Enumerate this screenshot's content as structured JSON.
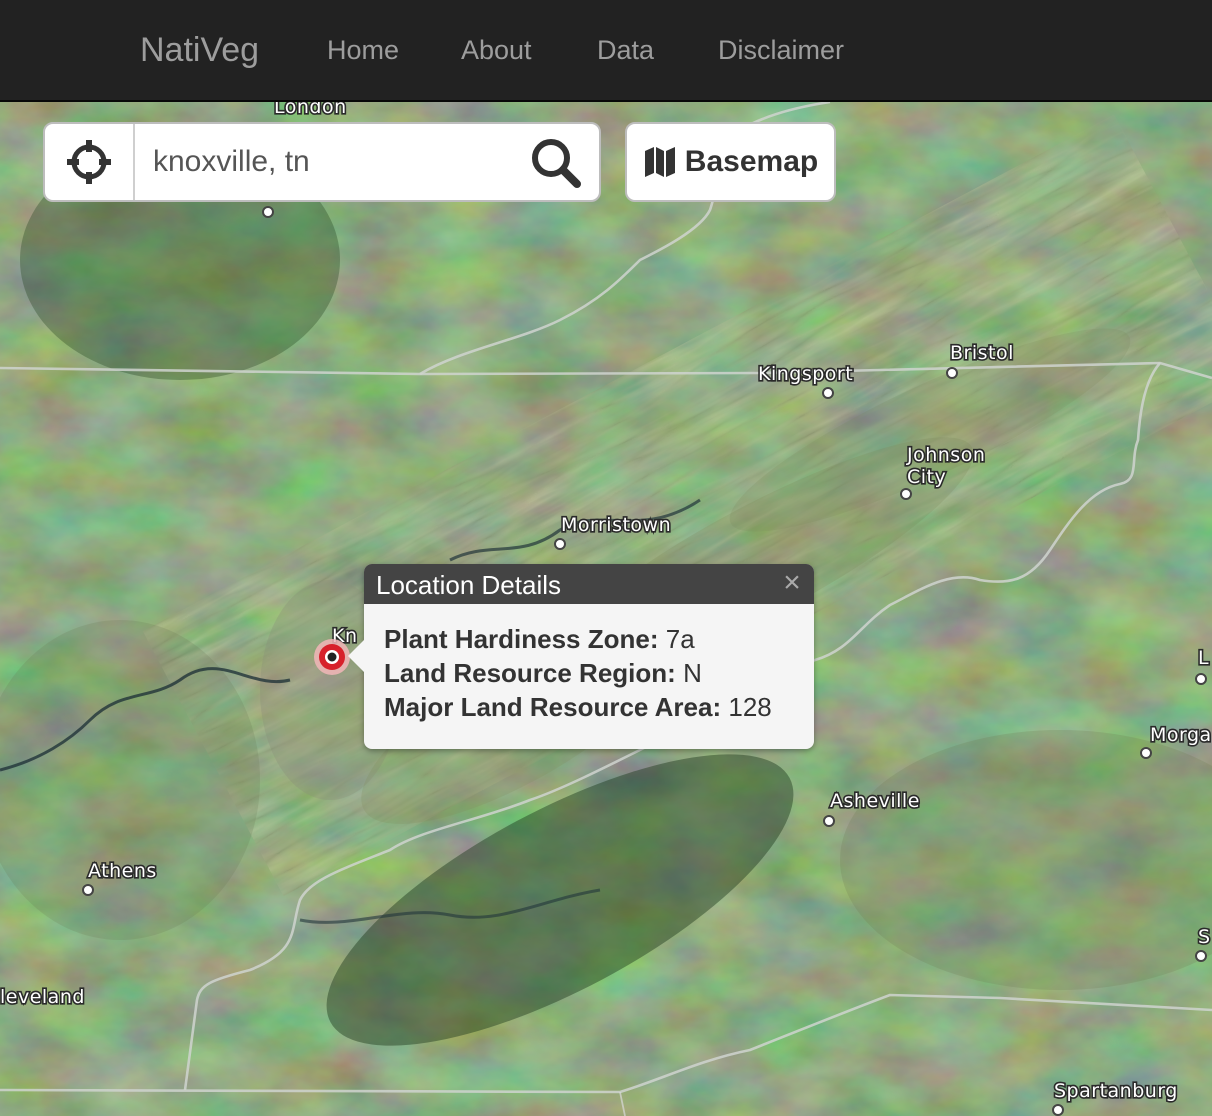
{
  "navbar": {
    "brand": "NatiVeg",
    "items": [
      {
        "label": "Home"
      },
      {
        "label": "About"
      },
      {
        "label": "Data"
      },
      {
        "label": "Disclaimer"
      }
    ]
  },
  "search": {
    "value": "knoxville, tn",
    "locate_icon": "crosshair-icon",
    "search_icon": "magnifier-icon"
  },
  "basemap": {
    "label": "Basemap",
    "icon": "map-icon"
  },
  "popup": {
    "title": "Location Details",
    "close_glyph": "×",
    "rows": [
      {
        "label": "Plant Hardiness Zone:",
        "value": "7a"
      },
      {
        "label": "Land Resource Region:",
        "value": "N"
      },
      {
        "label": "Major Land Resource Area:",
        "value": "128"
      }
    ]
  },
  "map": {
    "cities": [
      {
        "name": "London"
      },
      {
        "name": "Kingsport"
      },
      {
        "name": "Bristol"
      },
      {
        "name": "Johnson"
      },
      {
        "name": "City"
      },
      {
        "name": "Morristown"
      },
      {
        "name": "Kn"
      },
      {
        "name": "Asheville"
      },
      {
        "name": "Athens"
      },
      {
        "name": "leveland"
      },
      {
        "name": "Morga"
      },
      {
        "name": "Spartanburg"
      },
      {
        "name": "L"
      },
      {
        "name": "S"
      }
    ]
  },
  "colors": {
    "navbar_bg": "#222222",
    "nav_text": "#9d9d9d",
    "popup_header": "#444444",
    "marker": "#d7212b"
  }
}
